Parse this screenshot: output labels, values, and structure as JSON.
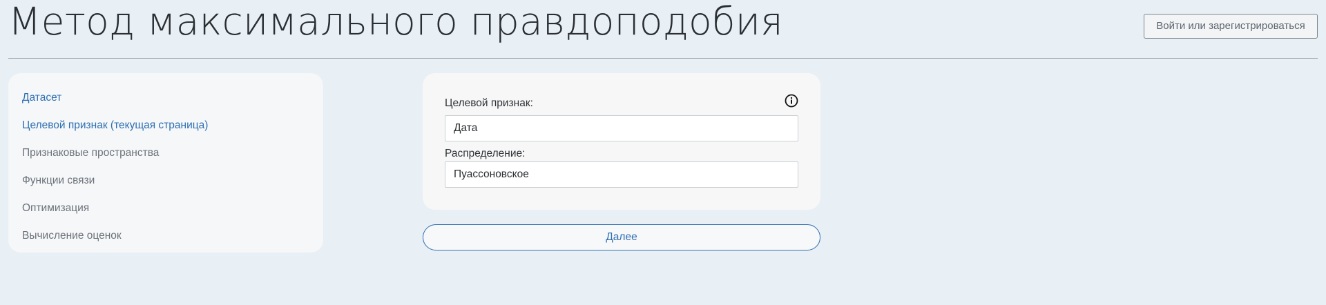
{
  "header": {
    "title": "Метод максимального правдоподобия",
    "login_label": "Войти или зарегистрироваться"
  },
  "sidebar": {
    "items": [
      {
        "label": "Датасет",
        "active": true
      },
      {
        "label": "Целевой признак (текущая страница)",
        "active": true
      },
      {
        "label": "Признаковые пространства",
        "active": false
      },
      {
        "label": "Функции связи",
        "active": false
      },
      {
        "label": "Оптимизация",
        "active": false
      },
      {
        "label": "Вычисление оценок",
        "active": false
      }
    ]
  },
  "form": {
    "target_label": "Целевой признак:",
    "target_value": "Дата",
    "distribution_label": "Распределение:",
    "distribution_value": "Пуассоновское",
    "info_icon": "info-icon"
  },
  "next_label": "Далее",
  "colors": {
    "accent": "#2e6fb3",
    "background": "#e8eff5",
    "panel": "#f5f7f9"
  }
}
